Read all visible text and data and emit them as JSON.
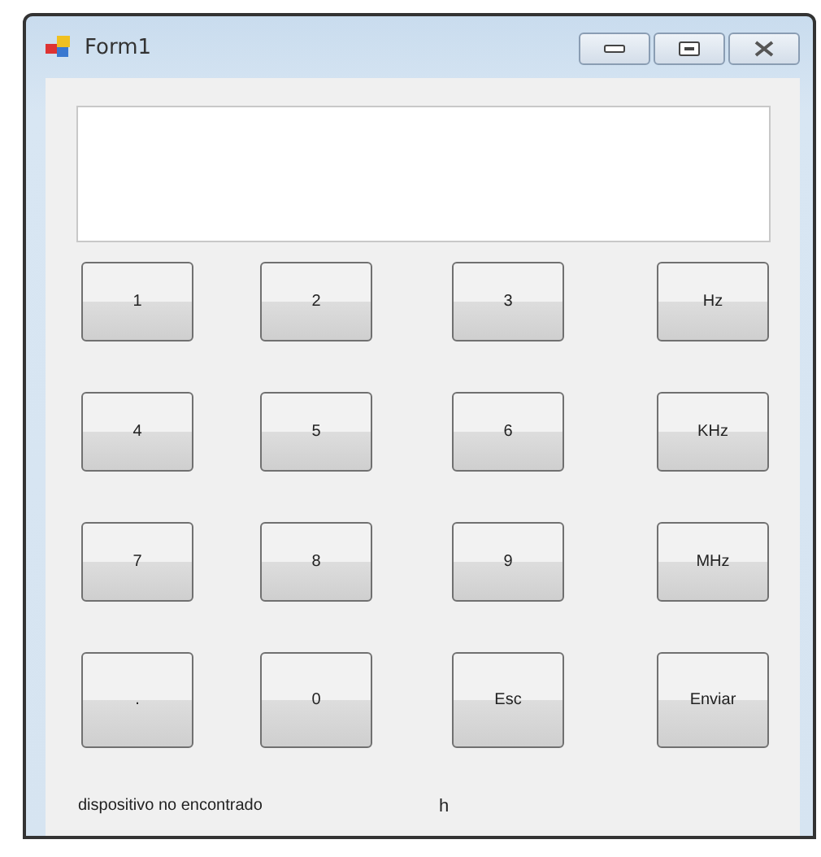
{
  "window": {
    "title": "Form1"
  },
  "keys": [
    {
      "label": "1"
    },
    {
      "label": "2"
    },
    {
      "label": "3"
    },
    {
      "label": "Hz"
    },
    {
      "label": "4"
    },
    {
      "label": "5"
    },
    {
      "label": "6"
    },
    {
      "label": "KHz"
    },
    {
      "label": "7"
    },
    {
      "label": "8"
    },
    {
      "label": "9"
    },
    {
      "label": "MHz"
    },
    {
      "label": "."
    },
    {
      "label": "0"
    },
    {
      "label": "Esc"
    },
    {
      "label": "Enviar"
    }
  ],
  "status": {
    "message": "dispositivo no encontrado",
    "unit": "h"
  }
}
